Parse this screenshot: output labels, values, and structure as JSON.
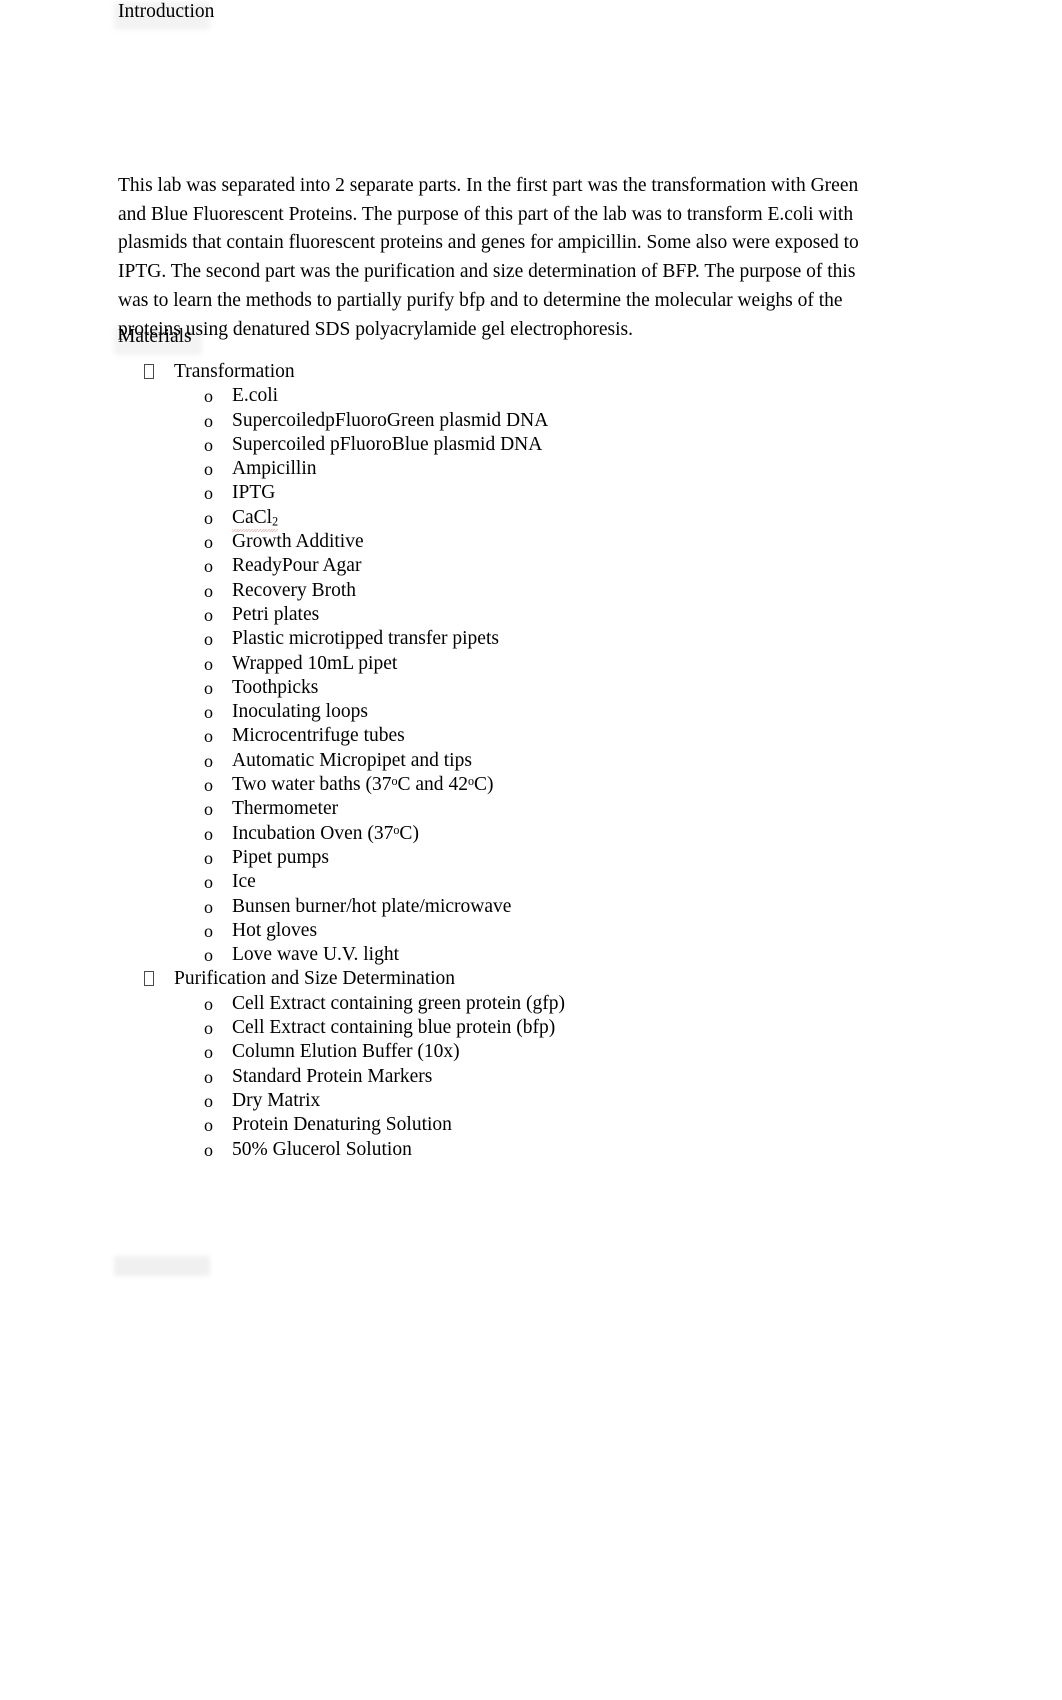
{
  "document": {
    "intro_heading": "Introduction",
    "intro_paragraph": "This lab was separated into 2 separate parts. In the first part was the transformation with Green and Blue Fluorescent Proteins. The purpose of this part of the lab was to transform E.coli with plasmids that contain fluorescent proteins and genes for ampicillin. Some also were exposed to IPTG. The second part was the purification and size determination of BFP. The purpose of this was to learn the methods to partially purify bfp and to determine the molecular weighs of the proteins using denatured SDS polyacrylamide gel electrophoresis.",
    "materials_heading": "Materials",
    "bullet_level1_marker": "missing-glyph-box",
    "bullet_level2_marker": "o",
    "sections": [
      {
        "title": "Transformation",
        "items": [
          "E.coli",
          "SupercoiledpFluoroGreen plasmid DNA",
          "Supercoiled pFluoroBlue plasmid DNA",
          "Ampicillin",
          "IPTG",
          "CaCl2",
          "Growth Additive",
          "ReadyPour Agar",
          "Recovery Broth",
          "Petri plates",
          "Plastic microtipped transfer pipets",
          "Wrapped 10mL pipet",
          "Toothpicks",
          "Inoculating loops",
          "Microcentrifuge tubes",
          "Automatic Micropipet and tips",
          "Two water baths (37oC and 42oC)",
          "Thermometer",
          "Incubation Oven (37oC)",
          "Pipet pumps",
          "Ice",
          "Bunsen burner/hot plate/microwave",
          "Hot gloves",
          "Love wave U.V. light"
        ]
      },
      {
        "title": "Purification and Size Determination",
        "items": [
          "Cell Extract containing green protein (gfp)",
          "Cell Extract containing blue protein (bfp)",
          "Column Elution Buffer (10x)",
          "Standard Protein Markers",
          "Dry Matrix",
          "Protein Denaturing Solution",
          "50% Glucerol Solution"
        ]
      }
    ],
    "colors": {
      "text": "#000000",
      "page_background": "#ffffff",
      "highlight_artifact": "#78787817",
      "spellcheck_underline": "#aa1e1e"
    }
  }
}
